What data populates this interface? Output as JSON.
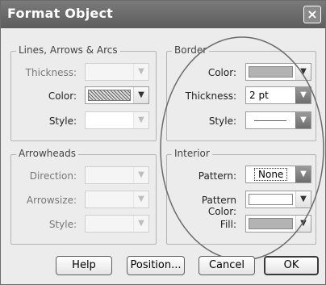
{
  "window": {
    "title": "Format Object",
    "close_glyph": "×"
  },
  "lines_group": {
    "title": "Lines, Arrows & Arcs",
    "thickness_label": "Thickness:",
    "color_label": "Color:",
    "style_label": "Style:"
  },
  "arrowheads_group": {
    "title": "Arrowheads",
    "direction_label": "Direction:",
    "arrowsize_label": "Arrowsize:",
    "style_label": "Style:"
  },
  "border_group": {
    "title": "Border",
    "color_label": "Color:",
    "thickness_label": "Thickness:",
    "thickness_value": "2 pt",
    "style_label": "Style:"
  },
  "interior_group": {
    "title": "Interior",
    "pattern_label": "Pattern:",
    "pattern_value": "None",
    "pattern_color_label": "Pattern Color:",
    "fill_label": "Fill:"
  },
  "buttons": {
    "help": "Help",
    "position": "Position...",
    "cancel": "Cancel",
    "ok": "OK"
  },
  "colors": {
    "title_bar": "#5d5d5d",
    "border_color_swatch": "#b3b3b3",
    "fill_swatch": "#b3b3b3"
  },
  "icons": {
    "dropdown": "chevron-down-icon",
    "close": "close-icon"
  }
}
